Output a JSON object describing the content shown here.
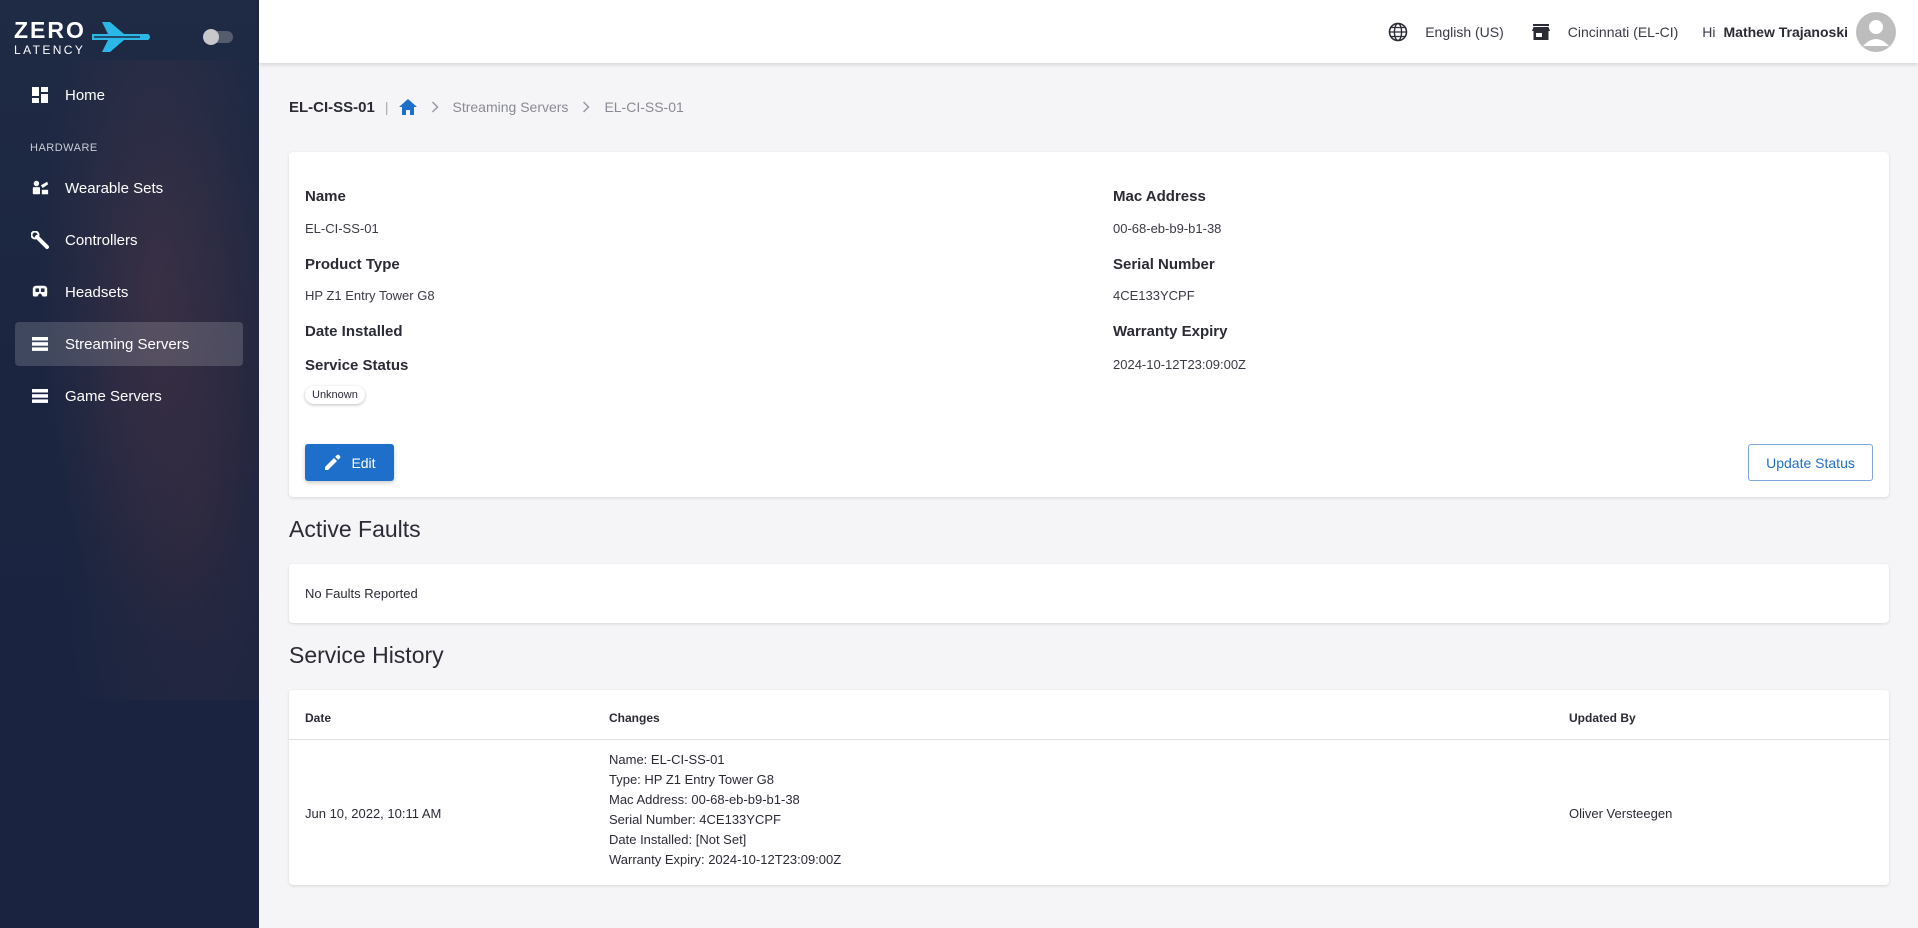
{
  "brand": {
    "line1": "ZERO",
    "line2": "LATENCY"
  },
  "sidebar": {
    "home_label": "Home",
    "section_label": "HARDWARE",
    "items": [
      {
        "label": "Wearable Sets",
        "icon": "wearable-set-icon"
      },
      {
        "label": "Controllers",
        "icon": "controller-icon"
      },
      {
        "label": "Headsets",
        "icon": "headset-icon"
      },
      {
        "label": "Streaming Servers",
        "icon": "server-icon",
        "active": true
      },
      {
        "label": "Game Servers",
        "icon": "server-icon"
      }
    ]
  },
  "topbar": {
    "language": "English (US)",
    "location": "Cincinnati (EL-CI)",
    "greeting": "Hi",
    "user_name": "Mathew Trajanoski"
  },
  "breadcrumb": {
    "title": "EL-CI-SS-01",
    "separator": "|",
    "crumbs": [
      "Streaming Servers",
      "EL-CI-SS-01"
    ]
  },
  "details": {
    "name_label": "Name",
    "name_value": "EL-CI-SS-01",
    "product_type_label": "Product Type",
    "product_type_value": "HP Z1 Entry Tower G8",
    "date_installed_label": "Date Installed",
    "service_status_label": "Service Status",
    "service_status_value": "Unknown",
    "mac_label": "Mac Address",
    "mac_value": "00-68-eb-b9-b1-38",
    "serial_label": "Serial Number",
    "serial_value": "4CE133YCPF",
    "warranty_label": "Warranty Expiry",
    "warranty_value": "2024-10-12T23:09:00Z",
    "edit_label": "Edit",
    "update_label": "Update Status"
  },
  "faults": {
    "title": "Active Faults",
    "empty_text": "No Faults Reported"
  },
  "history": {
    "title": "Service History",
    "columns": {
      "date": "Date",
      "changes": "Changes",
      "updated_by": "Updated By"
    },
    "rows": [
      {
        "date": "Jun 10, 2022, 10:11 AM",
        "changes": [
          "Name: EL-CI-SS-01",
          "Type: HP Z1 Entry Tower G8",
          "Mac Address: 00-68-eb-b9-b1-38",
          "Serial Number: 4CE133YCPF",
          "Date Installed: [Not Set]",
          "Warranty Expiry: 2024-10-12T23:09:00Z"
        ],
        "updated_by": "Oliver Versteegen"
      }
    ]
  },
  "colors": {
    "sidebar_bg": "#1f2a44",
    "primary": "#1e6fc9",
    "logo_accent": "#2bb8e8"
  }
}
